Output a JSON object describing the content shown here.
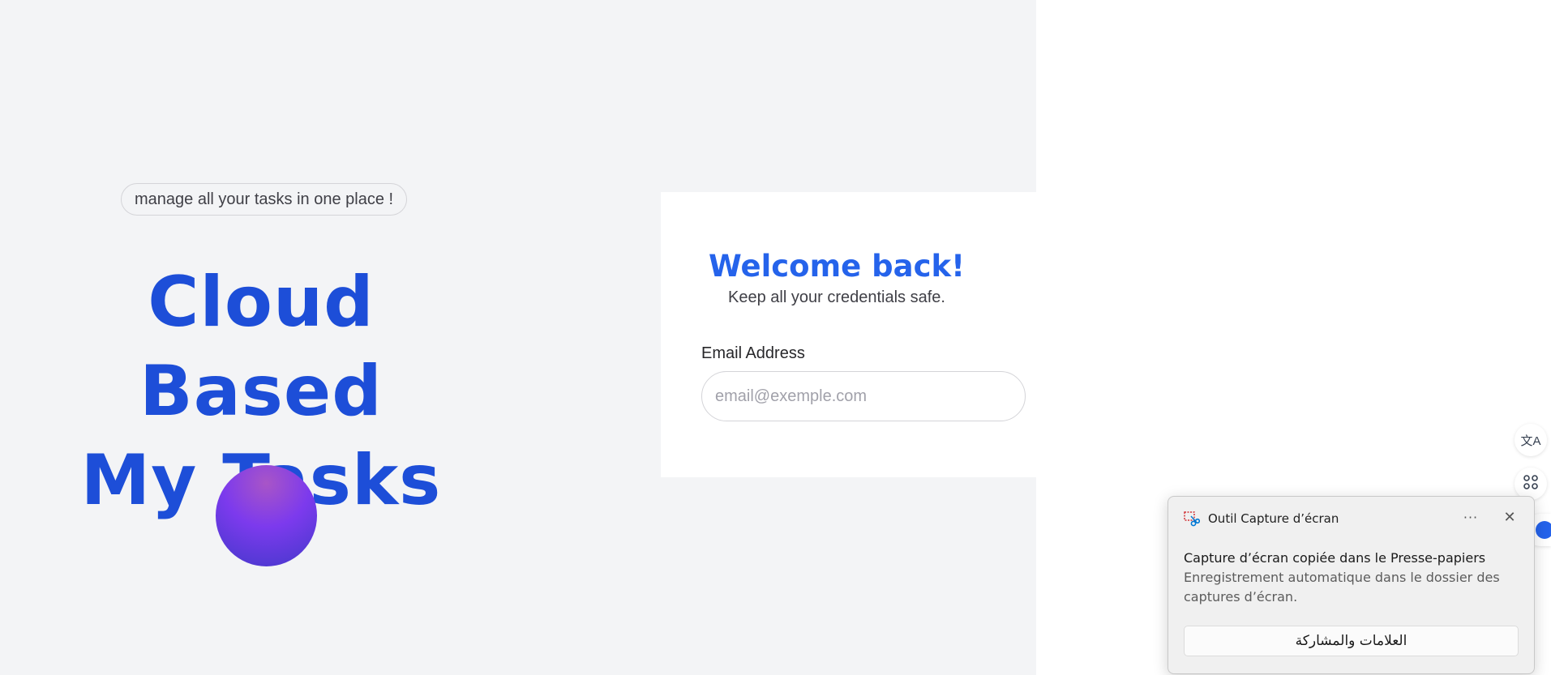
{
  "hero": {
    "tagline": "manage all your tasks in one place !",
    "title_line1": "Cloud Based",
    "title_line2": "My Tasks"
  },
  "login": {
    "title": "Welcome back!",
    "subtitle": "Keep all your credentials safe.",
    "email_label": "Email Address",
    "email_placeholder": "email@exemple.com",
    "email_value": ""
  },
  "side_buttons": [
    {
      "icon": "translate-icon",
      "glyph": "文A"
    },
    {
      "icon": "apps-icon",
      "glyph": "⌘"
    }
  ],
  "toast": {
    "app_name": "Outil Capture d’écran",
    "more_glyph": "···",
    "close_glyph": "✕",
    "title": "Capture d’écran copiée dans le Presse-papiers",
    "body": "Enregistrement automatique dans le dossier des captures d’écran.",
    "action_label": "العلامات والمشاركة"
  },
  "colors": {
    "accent": "#1d4ed8",
    "title_blue": "#2563eb",
    "panel_bg": "#f3f4f6"
  }
}
